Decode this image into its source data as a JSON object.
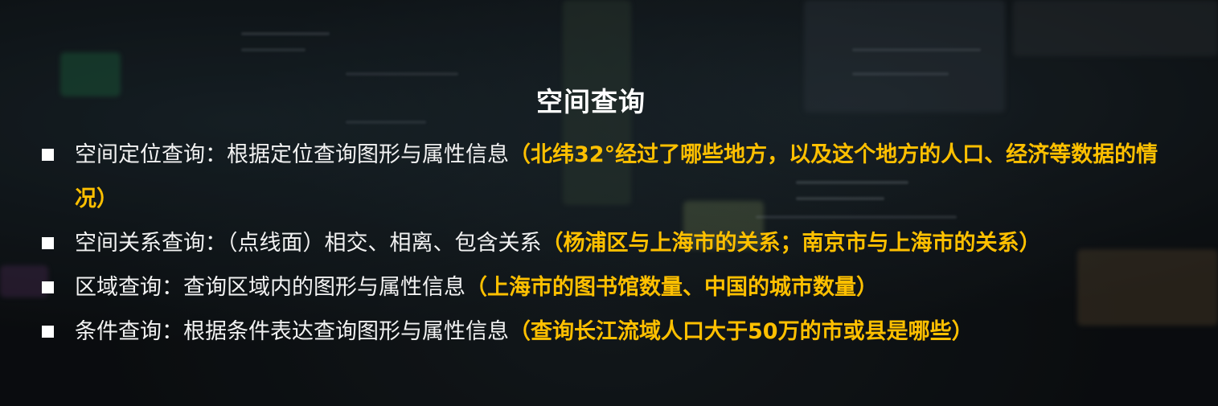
{
  "slide": {
    "title": "空间查询",
    "bullets": [
      {
        "label": "空间定位查询：根据定位查询图形与属性信息",
        "example": "（北纬32°经过了哪些地方，以及这个地方的人口、经济等数据的情况）"
      },
      {
        "label": "空间关系查询：（点线面）相交、相离、包含关系",
        "example": "（杨浦区与上海市的关系；南京市与上海市的关系）"
      },
      {
        "label": "区域查询：查询区域内的图形与属性信息",
        "example": "（上海市的图书馆数量、中国的城市数量）"
      },
      {
        "label": "条件查询：根据条件表达查询图形与属性信息",
        "example": "（查询长江流域人口大于50万的市或县是哪些）"
      }
    ]
  },
  "colors": {
    "title": "#ffffff",
    "body_text": "#f2f2f2",
    "highlight": "#ffc000",
    "bullet_marker": "#ffffff",
    "background": "#0e1114"
  }
}
